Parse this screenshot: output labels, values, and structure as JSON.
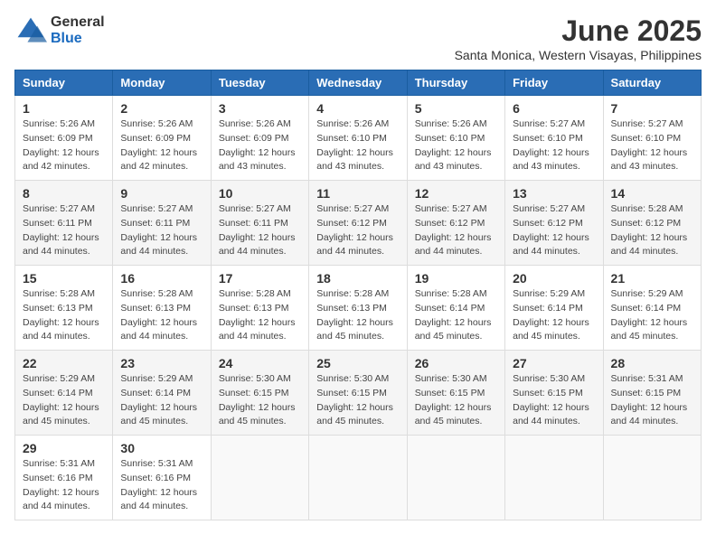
{
  "logo": {
    "general": "General",
    "blue": "Blue"
  },
  "title": "June 2025",
  "location": "Santa Monica, Western Visayas, Philippines",
  "weekdays": [
    "Sunday",
    "Monday",
    "Tuesday",
    "Wednesday",
    "Thursday",
    "Friday",
    "Saturday"
  ],
  "weeks": [
    [
      {
        "day": "1",
        "sunrise": "5:26 AM",
        "sunset": "6:09 PM",
        "daylight": "12 hours and 42 minutes."
      },
      {
        "day": "2",
        "sunrise": "5:26 AM",
        "sunset": "6:09 PM",
        "daylight": "12 hours and 42 minutes."
      },
      {
        "day": "3",
        "sunrise": "5:26 AM",
        "sunset": "6:09 PM",
        "daylight": "12 hours and 43 minutes."
      },
      {
        "day": "4",
        "sunrise": "5:26 AM",
        "sunset": "6:10 PM",
        "daylight": "12 hours and 43 minutes."
      },
      {
        "day": "5",
        "sunrise": "5:26 AM",
        "sunset": "6:10 PM",
        "daylight": "12 hours and 43 minutes."
      },
      {
        "day": "6",
        "sunrise": "5:27 AM",
        "sunset": "6:10 PM",
        "daylight": "12 hours and 43 minutes."
      },
      {
        "day": "7",
        "sunrise": "5:27 AM",
        "sunset": "6:10 PM",
        "daylight": "12 hours and 43 minutes."
      }
    ],
    [
      {
        "day": "8",
        "sunrise": "5:27 AM",
        "sunset": "6:11 PM",
        "daylight": "12 hours and 44 minutes."
      },
      {
        "day": "9",
        "sunrise": "5:27 AM",
        "sunset": "6:11 PM",
        "daylight": "12 hours and 44 minutes."
      },
      {
        "day": "10",
        "sunrise": "5:27 AM",
        "sunset": "6:11 PM",
        "daylight": "12 hours and 44 minutes."
      },
      {
        "day": "11",
        "sunrise": "5:27 AM",
        "sunset": "6:12 PM",
        "daylight": "12 hours and 44 minutes."
      },
      {
        "day": "12",
        "sunrise": "5:27 AM",
        "sunset": "6:12 PM",
        "daylight": "12 hours and 44 minutes."
      },
      {
        "day": "13",
        "sunrise": "5:27 AM",
        "sunset": "6:12 PM",
        "daylight": "12 hours and 44 minutes."
      },
      {
        "day": "14",
        "sunrise": "5:28 AM",
        "sunset": "6:12 PM",
        "daylight": "12 hours and 44 minutes."
      }
    ],
    [
      {
        "day": "15",
        "sunrise": "5:28 AM",
        "sunset": "6:13 PM",
        "daylight": "12 hours and 44 minutes."
      },
      {
        "day": "16",
        "sunrise": "5:28 AM",
        "sunset": "6:13 PM",
        "daylight": "12 hours and 44 minutes."
      },
      {
        "day": "17",
        "sunrise": "5:28 AM",
        "sunset": "6:13 PM",
        "daylight": "12 hours and 44 minutes."
      },
      {
        "day": "18",
        "sunrise": "5:28 AM",
        "sunset": "6:13 PM",
        "daylight": "12 hours and 45 minutes."
      },
      {
        "day": "19",
        "sunrise": "5:28 AM",
        "sunset": "6:14 PM",
        "daylight": "12 hours and 45 minutes."
      },
      {
        "day": "20",
        "sunrise": "5:29 AM",
        "sunset": "6:14 PM",
        "daylight": "12 hours and 45 minutes."
      },
      {
        "day": "21",
        "sunrise": "5:29 AM",
        "sunset": "6:14 PM",
        "daylight": "12 hours and 45 minutes."
      }
    ],
    [
      {
        "day": "22",
        "sunrise": "5:29 AM",
        "sunset": "6:14 PM",
        "daylight": "12 hours and 45 minutes."
      },
      {
        "day": "23",
        "sunrise": "5:29 AM",
        "sunset": "6:14 PM",
        "daylight": "12 hours and 45 minutes."
      },
      {
        "day": "24",
        "sunrise": "5:30 AM",
        "sunset": "6:15 PM",
        "daylight": "12 hours and 45 minutes."
      },
      {
        "day": "25",
        "sunrise": "5:30 AM",
        "sunset": "6:15 PM",
        "daylight": "12 hours and 45 minutes."
      },
      {
        "day": "26",
        "sunrise": "5:30 AM",
        "sunset": "6:15 PM",
        "daylight": "12 hours and 45 minutes."
      },
      {
        "day": "27",
        "sunrise": "5:30 AM",
        "sunset": "6:15 PM",
        "daylight": "12 hours and 44 minutes."
      },
      {
        "day": "28",
        "sunrise": "5:31 AM",
        "sunset": "6:15 PM",
        "daylight": "12 hours and 44 minutes."
      }
    ],
    [
      {
        "day": "29",
        "sunrise": "5:31 AM",
        "sunset": "6:16 PM",
        "daylight": "12 hours and 44 minutes."
      },
      {
        "day": "30",
        "sunrise": "5:31 AM",
        "sunset": "6:16 PM",
        "daylight": "12 hours and 44 minutes."
      },
      null,
      null,
      null,
      null,
      null
    ]
  ],
  "labels": {
    "sunrise": "Sunrise:",
    "sunset": "Sunset:",
    "daylight": "Daylight:"
  }
}
